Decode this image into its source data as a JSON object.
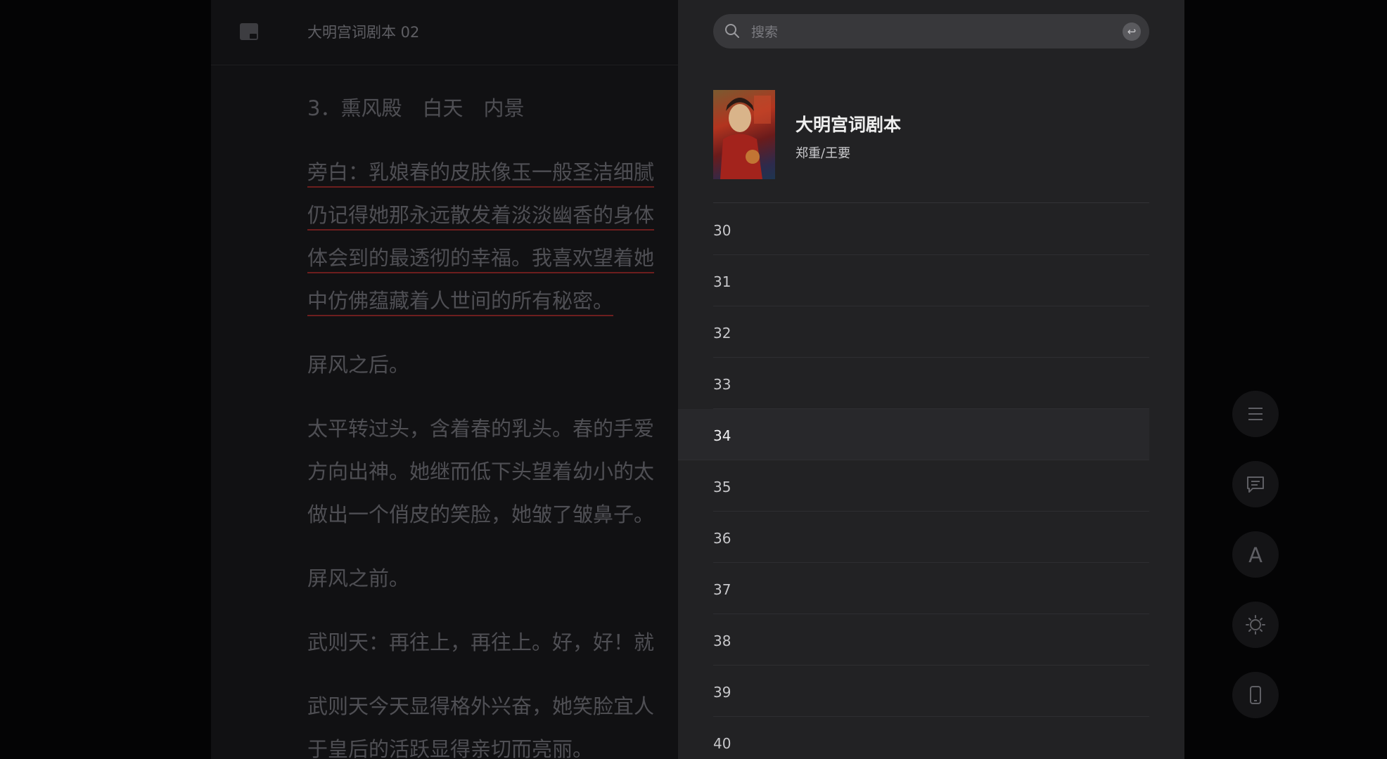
{
  "reader": {
    "title": "大明宫词剧本 02",
    "scene": "3．熏风殿　白天　内景",
    "para1": [
      "旁白：乳娘春的皮肤像玉一般圣洁细腻",
      "仍记得她那永远散发着淡淡幽香的身体",
      "体会到的最透彻的幸福。我喜欢望着她",
      "中仿佛蕴藏着人世间的所有秘密。"
    ],
    "para2": "屏风之后。",
    "para3": [
      "太平转过头，含着春的乳头。春的手爱",
      "方向出神。她继而低下头望着幼小的太",
      "做出一个俏皮的笑脸，她皱了皱鼻子。"
    ],
    "para4": "屏风之前。",
    "para5": "武则天：再往上，再往上。好，好！就",
    "para6": [
      "武则天今天显得格外兴奋，她笑脸宜人",
      "于皇后的活跃显得亲切而亮丽。"
    ]
  },
  "search": {
    "placeholder": "搜索",
    "return_icon": "return-icon"
  },
  "book": {
    "title": "大明宫词剧本",
    "author": "郑重/王要"
  },
  "toc": {
    "items": [
      "30",
      "31",
      "32",
      "33",
      "34",
      "35",
      "36",
      "37",
      "38",
      "39",
      "40"
    ],
    "active": "34"
  },
  "tools": [
    "menu-icon",
    "comment-icon",
    "font-icon",
    "brightness-icon",
    "phone-icon"
  ],
  "font_button_label": "A",
  "colors": {
    "panel_bg": "#222224",
    "reader_bg": "#111113",
    "underline": "#6d1e1e"
  }
}
